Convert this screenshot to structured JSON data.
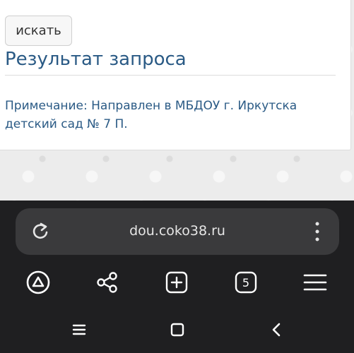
{
  "search": {
    "button_label": "искать"
  },
  "result": {
    "title": "Результат запроса",
    "note_line1": "Примечание: Направлен в МБДОУ г. Иркутска",
    "note_line2": "детский сад № 7 П."
  },
  "browser": {
    "url": "dou.coko38.ru",
    "tab_count": "5",
    "icons": [
      "reload-icon",
      "more-vert-icon",
      "alice-icon",
      "share-icon",
      "new-tab-icon",
      "tabs-icon",
      "menu-icon"
    ]
  },
  "system_nav": {
    "icons": [
      "recent-apps-icon",
      "home-icon",
      "back-icon"
    ]
  },
  "colors": {
    "accent": "#2a5a85",
    "browser_bg": "#1f1f21",
    "url_bar_bg": "#3a3a3c"
  }
}
